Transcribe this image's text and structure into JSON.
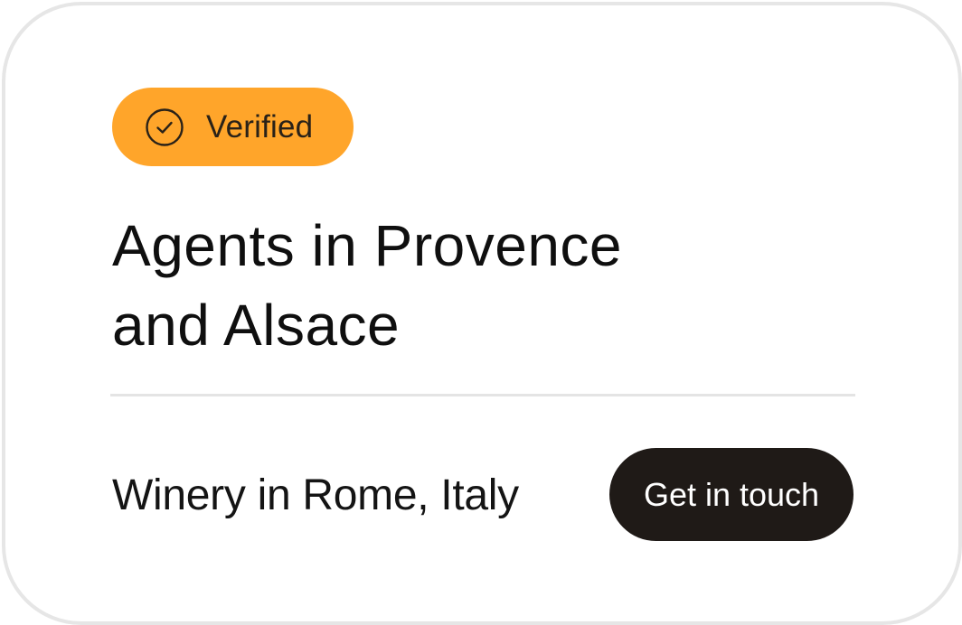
{
  "card": {
    "badge": {
      "icon": "check-circle-icon",
      "label": "Verified",
      "color": "#ffa52a"
    },
    "title_line1": "Agents in Provence",
    "title_line2": "and Alsace",
    "location": "Winery in Rome, Italy",
    "cta": {
      "label": "Get in touch",
      "color": "#1f1a17"
    }
  }
}
